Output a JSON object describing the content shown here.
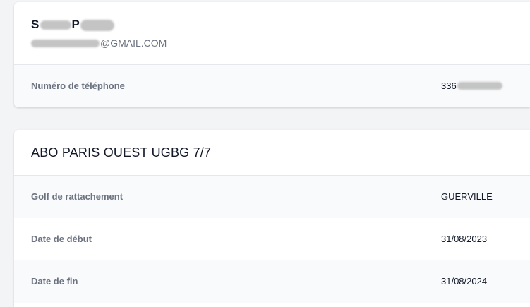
{
  "profile": {
    "name_start": "S",
    "name_middle": "P",
    "email_suffix": "@GMAIL.COM",
    "phone": {
      "label": "Numéro de téléphone",
      "value_prefix": "336"
    }
  },
  "subscription": {
    "title": "ABO PARIS OUEST UGBG 7/7",
    "rows": [
      {
        "label": "Golf de rattachement",
        "value": "GUERVILLE"
      },
      {
        "label": "Date de début",
        "value": "31/08/2023"
      },
      {
        "label": "Date de fin",
        "value": "31/08/2024"
      }
    ]
  },
  "colors": {
    "background": "#f3f4f6",
    "card": "#ffffff",
    "row_alt": "#f9fafb",
    "label": "#6b7280",
    "text": "#111827"
  }
}
